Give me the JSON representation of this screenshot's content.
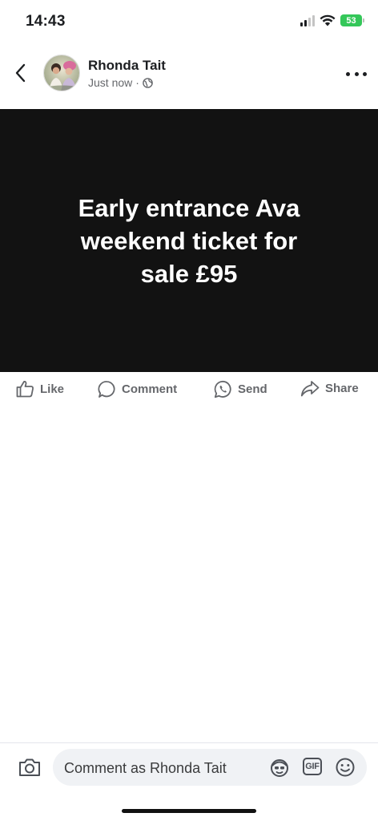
{
  "status_bar": {
    "time": "14:43",
    "battery": "53",
    "icons": [
      "signal-icon",
      "wifi-icon",
      "battery-icon"
    ]
  },
  "post": {
    "author": "Rhonda Tait",
    "timestamp": "Just now",
    "separator": "·",
    "audience_icon": "globe-icon",
    "text": "Early entrance Ava\nweekend  ticket for\nsale £95",
    "background_color": "#121212",
    "text_color": "#ffffff"
  },
  "actions": {
    "like": "Like",
    "comment": "Comment",
    "send": "Send",
    "share": "Share"
  },
  "composer": {
    "placeholder": "Comment as Rhonda Tait",
    "gif_label": "GIF",
    "icons": [
      "camera-icon",
      "avatar-sticker-icon",
      "gif-icon",
      "emoji-icon"
    ]
  }
}
